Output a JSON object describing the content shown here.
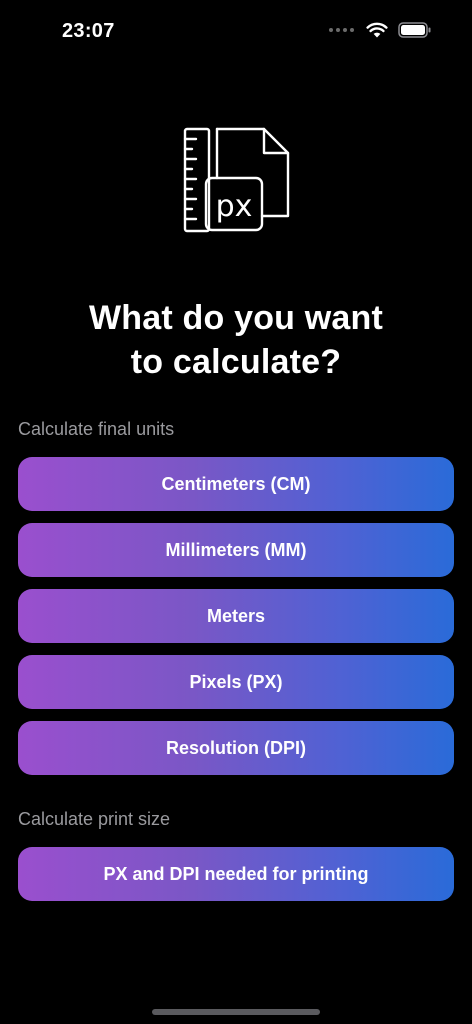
{
  "status_bar": {
    "time": "23:07"
  },
  "hero": {
    "icon_name": "ruler-document-px-icon",
    "icon_text": "px"
  },
  "title": {
    "line1": "What do you want",
    "line2": "to calculate?"
  },
  "final_units": {
    "label": "Calculate final units",
    "options": [
      {
        "label": "Centimeters (CM)"
      },
      {
        "label": "Millimeters (MM)"
      },
      {
        "label": "Meters"
      },
      {
        "label": "Pixels (PX)"
      },
      {
        "label": "Resolution (DPI)"
      }
    ]
  },
  "print_size": {
    "label": "Calculate print size",
    "options": [
      {
        "label": "PX and DPI needed for printing"
      }
    ]
  },
  "colors": {
    "background": "#000000",
    "gradient_start": "#9a4fce",
    "gradient_end": "#2a6bd8",
    "section_label": "#9a9a9e"
  }
}
